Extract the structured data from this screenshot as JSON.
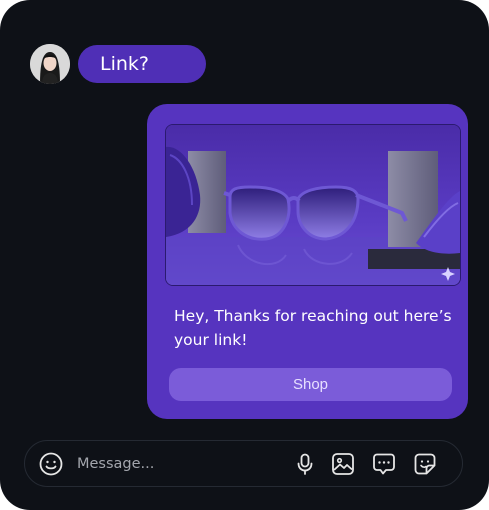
{
  "conversation": {
    "incoming_message": "Link?",
    "reply_card": {
      "product_image": "purple-sunglasses-image",
      "message": "Hey, Thanks for reaching out here’s your link!",
      "button_label": "Shop"
    }
  },
  "composer": {
    "placeholder": "Message...",
    "icons": [
      "smile-icon",
      "microphone-icon",
      "image-icon",
      "chat-bubble-icon",
      "sticker-icon"
    ]
  },
  "colors": {
    "background": "#0e1117",
    "accent": "#5634bf",
    "bubble": "#4f2fb6",
    "button": "#7b5cd9"
  }
}
